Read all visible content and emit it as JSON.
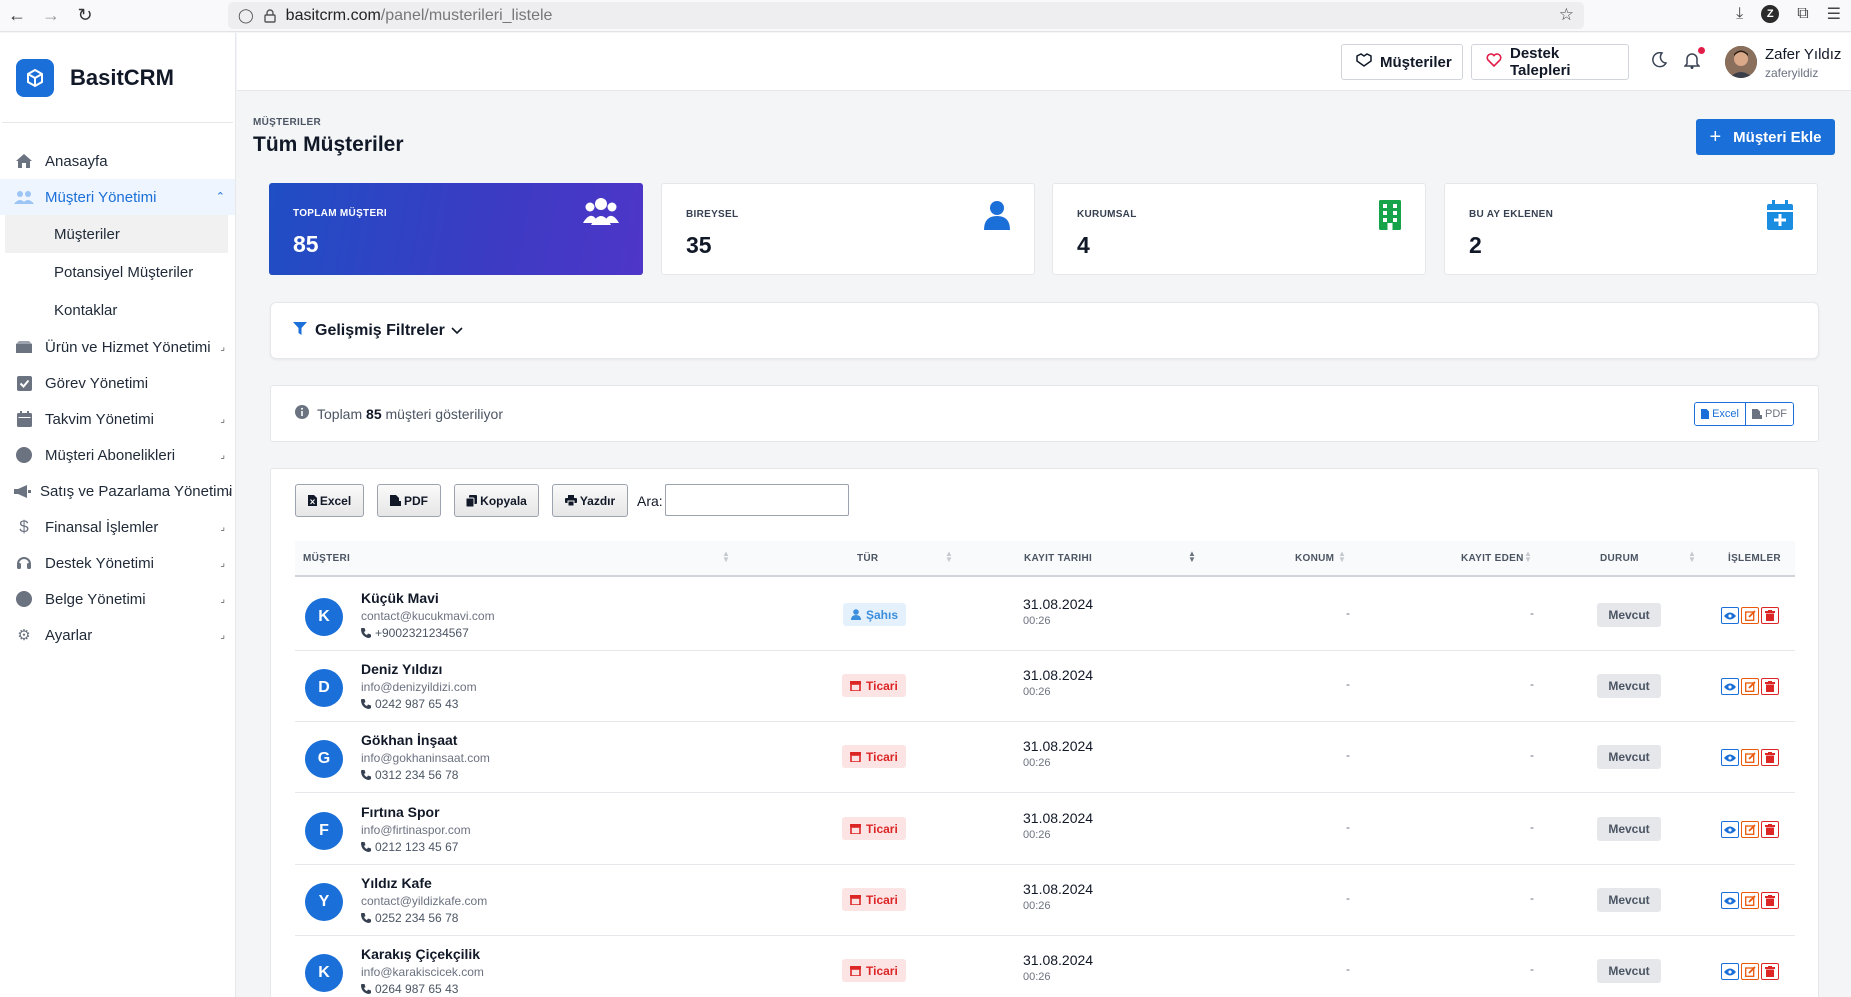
{
  "browser": {
    "url_host": "basitcrm.com",
    "url_path": "/panel/musterileri_listele"
  },
  "brand": {
    "name": "BasitCRM"
  },
  "sidebar": {
    "items": [
      {
        "label": "Anasayfa",
        "icon": "home-icon"
      },
      {
        "label": "Müşteri Yönetimi",
        "icon": "users-icon"
      },
      {
        "label": "Ürün ve Hizmet Yönetimi",
        "icon": "box-icon"
      },
      {
        "label": "Görev Yönetimi",
        "icon": "check-square-icon"
      },
      {
        "label": "Takvim Yönetimi",
        "icon": "calendar-icon"
      },
      {
        "label": "Müşteri Abonelikleri",
        "icon": "circle-icon"
      },
      {
        "label": "Satış ve Pazarlama Yönetimi",
        "icon": "megaphone-icon"
      },
      {
        "label": "Finansal İşlemler",
        "icon": "dollar-icon"
      },
      {
        "label": "Destek Yönetimi",
        "icon": "headset-icon"
      },
      {
        "label": "Belge Yönetimi",
        "icon": "circle-icon"
      },
      {
        "label": "Ayarlar",
        "icon": "gears-icon"
      }
    ],
    "sub_items": [
      "Müşteriler",
      "Potansiyel Müşteriler",
      "Kontaklar"
    ]
  },
  "topbar": {
    "customers_label": "Müşteriler",
    "support_label": "Destek Talepleri",
    "user_name": "Zafer Yıldız",
    "user_handle": "zaferyildiz"
  },
  "page": {
    "breadcrumb": "MÜŞTERILER",
    "title": "Tüm Müşteriler",
    "add_button": "Müşteri Ekle"
  },
  "stats": [
    {
      "label": "TOPLAM MÜŞTERI",
      "value": "85",
      "icon": "users-icon"
    },
    {
      "label": "BIREYSEL",
      "value": "35",
      "icon": "user-icon"
    },
    {
      "label": "KURUMSAL",
      "value": "4",
      "icon": "building-icon"
    },
    {
      "label": "BU AY EKLENEN",
      "value": "2",
      "icon": "calendar-plus-icon"
    }
  ],
  "filters": {
    "title": "Gelişmiş Filtreler"
  },
  "info": {
    "prefix": "Toplam",
    "count": "85",
    "suffix": "müşteri gösteriliyor",
    "excel": "Excel",
    "pdf": "PDF"
  },
  "table_tools": {
    "excel": "Excel",
    "pdf": "PDF",
    "copy": "Kopyala",
    "print": "Yazdır",
    "search_label": "Ara:",
    "search_value": ""
  },
  "table": {
    "headers": [
      "MÜŞTERI",
      "TÜR",
      "KAYIT TARIHI",
      "KONUM",
      "KAYIT EDEN",
      "DURUM",
      "İŞLEMLER"
    ],
    "rows": [
      {
        "initial": "K",
        "name": "Küçük Mavi",
        "email": "contact@kucukmavi.com",
        "phone": "+9002321234567",
        "type": "Şahıs",
        "date": "31.08.2024",
        "time": "00:26",
        "location": "-",
        "recorded_by": "-",
        "status": "Mevcut"
      },
      {
        "initial": "D",
        "name": "Deniz Yıldızı",
        "email": "info@denizyildizi.com",
        "phone": "0242 987 65 43",
        "type": "Ticari",
        "date": "31.08.2024",
        "time": "00:26",
        "location": "-",
        "recorded_by": "-",
        "status": "Mevcut"
      },
      {
        "initial": "G",
        "name": "Gökhan İnşaat",
        "email": "info@gokhaninsaat.com",
        "phone": "0312 234 56 78",
        "type": "Ticari",
        "date": "31.08.2024",
        "time": "00:26",
        "location": "-",
        "recorded_by": "-",
        "status": "Mevcut"
      },
      {
        "initial": "F",
        "name": "Fırtına Spor",
        "email": "info@firtinaspor.com",
        "phone": "0212 123 45 67",
        "type": "Ticari",
        "date": "31.08.2024",
        "time": "00:26",
        "location": "-",
        "recorded_by": "-",
        "status": "Mevcut"
      },
      {
        "initial": "Y",
        "name": "Yıldız Kafe",
        "email": "contact@yildizkafe.com",
        "phone": "0252 234 56 78",
        "type": "Ticari",
        "date": "31.08.2024",
        "time": "00:26",
        "location": "-",
        "recorded_by": "-",
        "status": "Mevcut"
      },
      {
        "initial": "K",
        "name": "Karakış Çiçekçilik",
        "email": "info@karakiscicek.com",
        "phone": "0264 987 65 43",
        "type": "Ticari",
        "date": "31.08.2024",
        "time": "00:26",
        "location": "-",
        "recorded_by": "-",
        "status": "Mevcut"
      }
    ]
  },
  "colors": {
    "accent": "#1a6fd8",
    "stat_green": "#16a34a",
    "danger": "#dc2626",
    "warning": "#ea580c"
  }
}
